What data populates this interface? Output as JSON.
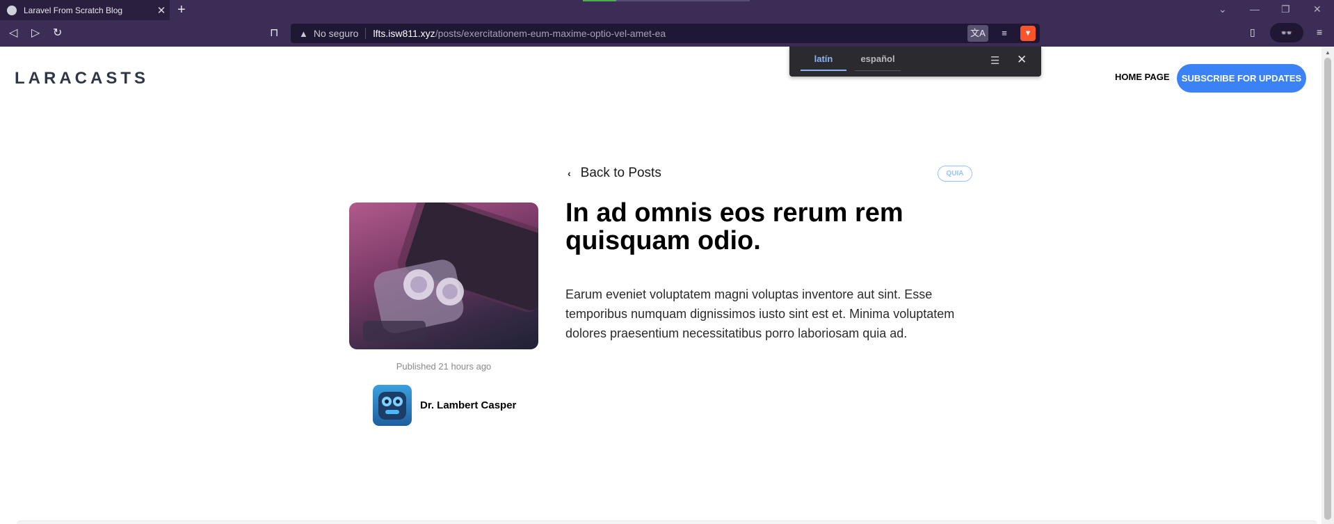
{
  "browser": {
    "tab_title": "Laravel From Scratch Blog",
    "tab_close": "✕",
    "new_tab": "+",
    "security_label": "No seguro",
    "url_host": "lfts.isw811.xyz",
    "url_path": "/posts/exercitationem-eum-maxime-optio-vel-amet-ea"
  },
  "translate": {
    "source_lang": "latín",
    "target_lang": "español"
  },
  "site": {
    "logo": "LARACASTS",
    "nav_home": "HOME PAGE",
    "subscribe": "SUBSCRIBE FOR UPDATES"
  },
  "post": {
    "back_label": "Back to Posts",
    "category": "QUIA",
    "published": "Published 21 hours ago",
    "author": "Dr. Lambert Casper",
    "title": "In ad omnis eos rerum rem quisquam odio.",
    "body": "Earum eveniet voluptatem magni voluptas inventore aut sint. Esse temporibus numquam dignissimos iusto sint est et. Minima voluptatem dolores praesentium necessitatibus porro laboriosam quia ad."
  },
  "colors": {
    "browser_bg": "#3b2d55",
    "accent_blue": "#3b82f6",
    "badge_blue": "#93c5fd"
  }
}
